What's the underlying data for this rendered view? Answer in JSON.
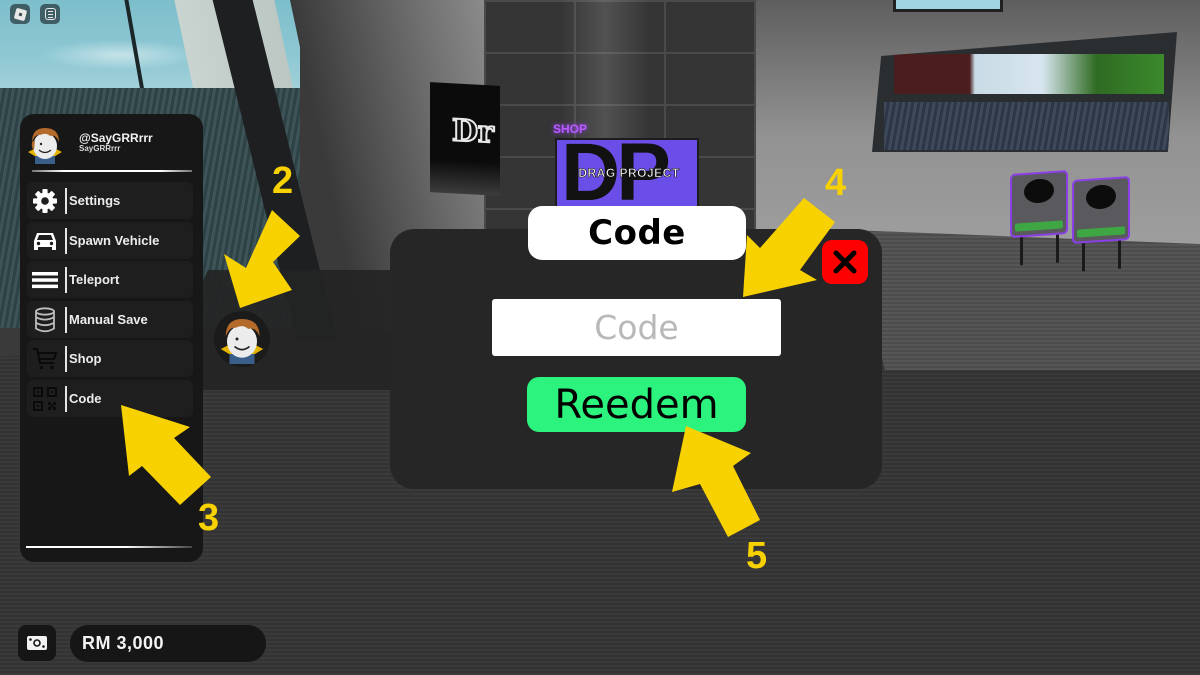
{
  "top_buttons": [
    {
      "icon": "roblox-menu-icon"
    },
    {
      "icon": "chat-icon"
    }
  ],
  "scene": {
    "shop_sign": "SHOP",
    "shop_screen_logo": "DP",
    "shop_screen_text": "DRAG PROJECT",
    "banner_text": "Dr"
  },
  "side_menu": {
    "profile": {
      "display_name": "@SayGRRrrr",
      "username": "SayGRRrrr"
    },
    "items": [
      {
        "label": "Settings",
        "icon": "gear-icon"
      },
      {
        "label": "Spawn Vehicle",
        "icon": "car-icon"
      },
      {
        "label": "Teleport",
        "icon": "menu-lines-icon"
      },
      {
        "label": "Manual Save",
        "icon": "database-icon"
      },
      {
        "label": "Shop",
        "icon": "cart-icon"
      },
      {
        "label": "Code",
        "icon": "qr-code-icon"
      }
    ]
  },
  "currency": {
    "icon": "cash-icon",
    "amount": "RM 3,000"
  },
  "code_dialog": {
    "title": "Code",
    "input_placeholder": "Code",
    "input_value": "",
    "redeem_label": "Reedem",
    "close_icon": "close-icon"
  },
  "annotations": [
    {
      "number": "2",
      "target": "avatar-button"
    },
    {
      "number": "3",
      "target": "menu-item-code"
    },
    {
      "number": "4",
      "target": "code-input"
    },
    {
      "number": "5",
      "target": "redeem-button"
    }
  ],
  "colors": {
    "annotation_yellow": "#f8d100",
    "redeem_green": "#2cf37d",
    "close_red": "#ff0000",
    "panel_dark": "#171717",
    "dialog_dark": "#262626",
    "shop_purple": "#6b4ee8"
  }
}
